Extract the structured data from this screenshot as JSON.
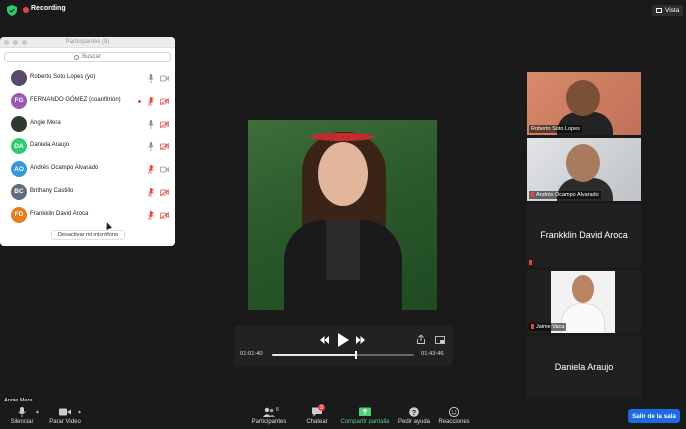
{
  "topbar": {
    "recording_label": "Recording",
    "view_label": "Vista"
  },
  "participants_panel": {
    "title": "Participantes (8)",
    "search_placeholder": "Buscar",
    "participants": [
      {
        "name": "Roberto Soto Lopes (yo)",
        "initials": "",
        "avatar_color": "#5a4a6a",
        "mic": "on",
        "video": "on",
        "talking_dot": false
      },
      {
        "name": "FERNANDO GÓMEZ (coanfitrión)",
        "initials": "FG",
        "avatar_color": "#9b59b6",
        "mic": "muted",
        "video": "off",
        "talking_dot": true
      },
      {
        "name": "Angie Mera",
        "initials": "",
        "avatar_color": "#2e3a2e",
        "mic": "on",
        "video": "off",
        "talking_dot": false
      },
      {
        "name": "Daniela Araujo",
        "initials": "DA",
        "avatar_color": "#2ecc71",
        "mic": "on",
        "video": "off",
        "talking_dot": false
      },
      {
        "name": "Andrés Ocampo Alvarado",
        "initials": "AO",
        "avatar_color": "#3498db",
        "mic": "muted",
        "video": "on",
        "talking_dot": false
      },
      {
        "name": "Brithany Castillo",
        "initials": "BC",
        "avatar_color": "#5d6d7e",
        "mic": "muted",
        "video": "off",
        "talking_dot": false
      },
      {
        "name": "Frankklin David Aroca",
        "initials": "FD",
        "avatar_color": "#e67e22",
        "mic": "muted",
        "video": "off",
        "talking_dot": false
      }
    ],
    "mute_me_label": "Desactivar mi micrófono"
  },
  "player": {
    "current_time": "01:01:40",
    "total_time": "01:43:46",
    "progress_fraction": 0.59
  },
  "thumbnails": [
    {
      "name": "Roberto Soto Lopes",
      "kind": "video-a",
      "muted": false
    },
    {
      "name": "Andrés Ocampo Alvarado",
      "kind": "video-b",
      "muted": true
    },
    {
      "name": "Frankklin David Aroca",
      "kind": "name-only",
      "muted": true
    },
    {
      "name": "Jaime Vaca",
      "kind": "photo",
      "muted": true
    },
    {
      "name": "Daniela Araujo",
      "kind": "name-only",
      "muted": false
    }
  ],
  "active_speaker": "Angie Mera",
  "toolbar": {
    "mute_label": "Silenciar",
    "video_label": "Parar Video",
    "participants_label": "Participantes",
    "participants_count": "8",
    "chat_label": "Chatear",
    "chat_badge": "2",
    "share_label": "Compartir pantalla",
    "help_label": "Pedir ayuda",
    "reactions_label": "Reacciones",
    "leave_label": "Salir de la sala"
  },
  "colors": {
    "accent_blue": "#1d6ae5",
    "share_green": "#4ad17a",
    "alert_red": "#e64545"
  }
}
